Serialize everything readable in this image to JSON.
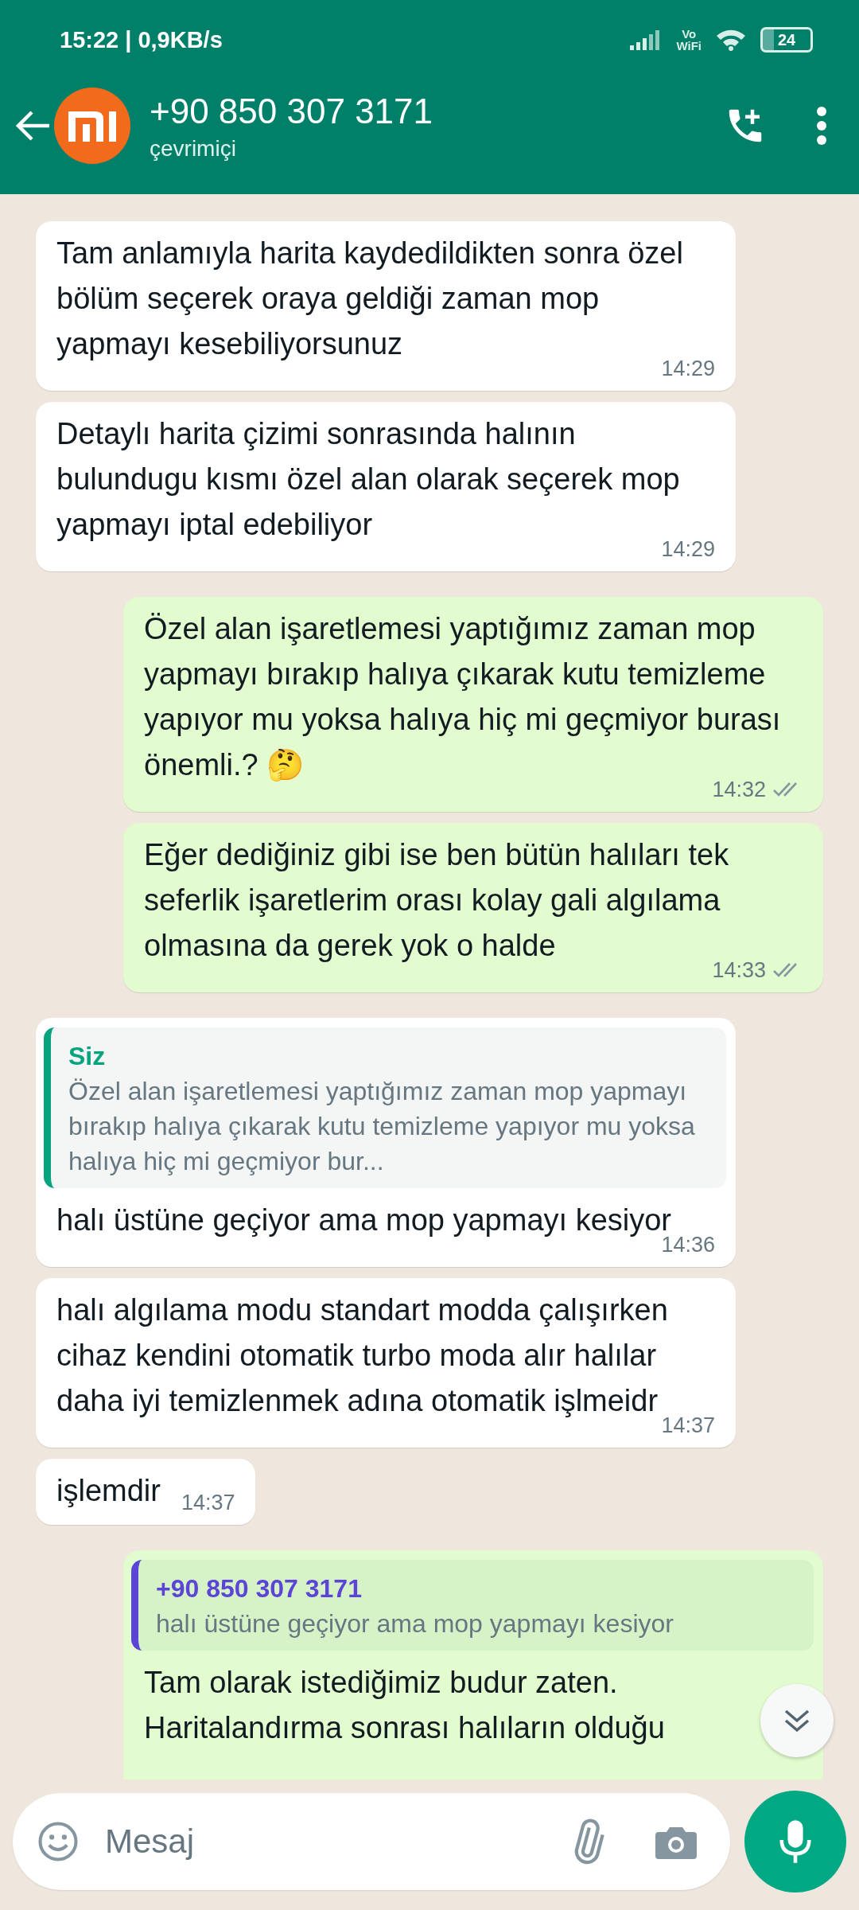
{
  "status_bar": {
    "time": "15:22 | 0,9KB/s",
    "network_label_top": "Vo",
    "network_label_bottom": "WiFi",
    "battery": "24"
  },
  "header": {
    "title": "+90 850 307 3171",
    "subtitle": "çevrimiçi"
  },
  "messages": [
    {
      "kind": "incoming",
      "text": "Tam anlamıyla harita kaydedildikten sonra özel bölüm seçerek oraya geldiği zaman mop yapmayı kesebiliyorsunuz",
      "time": "14:29"
    },
    {
      "kind": "incoming",
      "text": "Detaylı harita çizimi sonrasında halının bulundugu kısmı özel alan olarak seçerek mop yapmayı iptal edebiliyor",
      "time": "14:29"
    },
    {
      "kind": "outgoing",
      "text": "Özel alan işaretlemesi yaptığımız zaman mop yapmayı bırakıp halıya çıkarak kutu temizleme yapıyor mu yoksa halıya hiç mi geçmiyor burası önemli.? 🤔",
      "time": "14:32",
      "read": false
    },
    {
      "kind": "outgoing",
      "text": "Eğer dediğiniz gibi ise ben bütün halıları tek seferlik işaretlerim orası kolay gali algılama olmasına da gerek yok o halde",
      "time": "14:33",
      "read": false
    },
    {
      "kind": "incoming",
      "reply": {
        "author": "Siz",
        "color": "#06a37f",
        "text": "Özel alan işaretlemesi yaptığımız zaman mop yapmayı bırakıp halıya çıkarak kutu temizleme yapıyor mu yoksa halıya hiç mi geçmiyor bur..."
      },
      "text": "halı üstüne geçiyor ama mop yapmayı kesiyor",
      "time": "14:36"
    },
    {
      "kind": "incoming",
      "text": "halı algılama modu standart modda çalışırken cihaz kendini otomatik turbo moda alır halılar daha iyi temizlenmek adına otomatik işlmeidr",
      "time": "14:37"
    },
    {
      "kind": "incoming",
      "text": "işlemdir",
      "time": "14:37"
    },
    {
      "kind": "outgoing",
      "reply": {
        "author": "+90 850 307 3171",
        "color": "#5b44d6",
        "text": "halı üstüne geçiyor ama mop yapmayı kesiyor"
      },
      "text": "Tam olarak istediğimiz budur zaten. Haritalandırma sonrası halıların olduğu"
    }
  ],
  "input": {
    "placeholder": "Mesaj"
  }
}
